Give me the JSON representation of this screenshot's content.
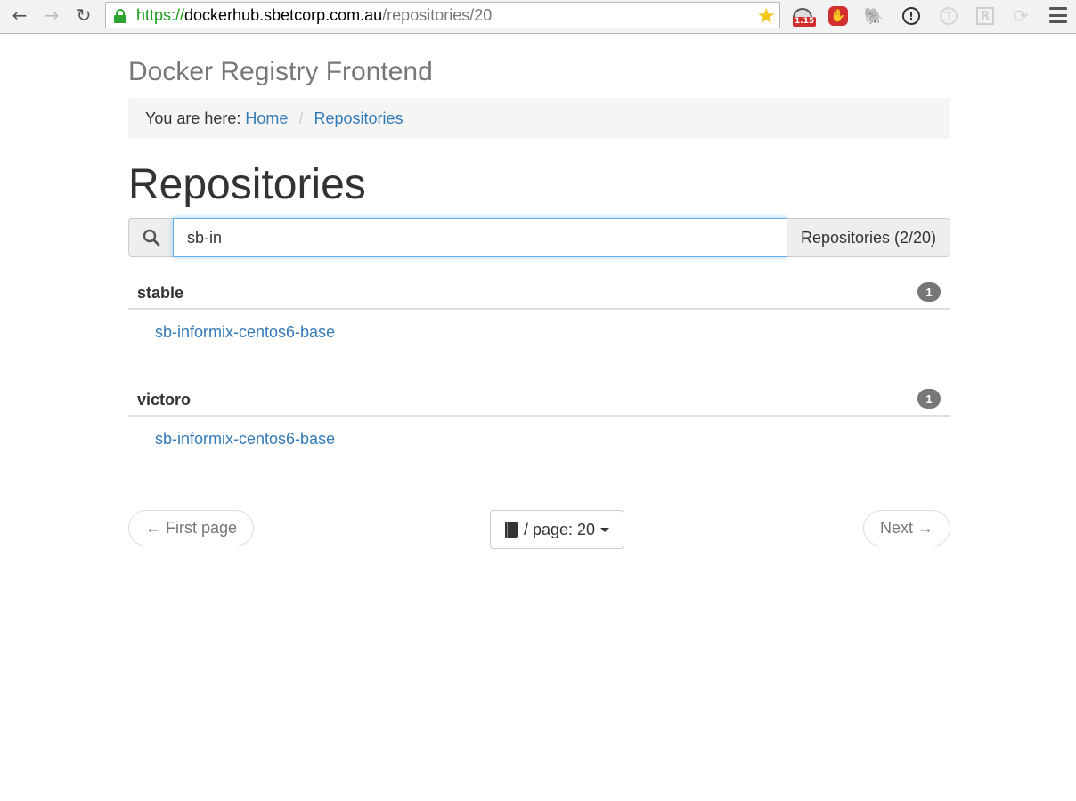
{
  "browser": {
    "url_scheme": "https://",
    "url_host": "dockerhub.sbetcorp.com.au",
    "url_path": "/repositories/20",
    "speed_badge": "1.15"
  },
  "app": {
    "title": "Docker Registry Frontend"
  },
  "breadcrumb": {
    "prefix": "You are here:",
    "items": [
      "Home",
      "Repositories"
    ],
    "separator": "/"
  },
  "page": {
    "heading": "Repositories"
  },
  "search": {
    "value": "sb-in",
    "count_label": "Repositories (2/20)"
  },
  "groups": [
    {
      "name": "stable",
      "count": "1",
      "repos": [
        "sb-informix-centos6-base"
      ]
    },
    {
      "name": "victoro",
      "count": "1",
      "repos": [
        "sb-informix-centos6-base"
      ]
    }
  ],
  "pager": {
    "first_label": "← First page",
    "page_label": "/ page: 20",
    "next_label": "Next →"
  },
  "colors": {
    "link": "#337ab7",
    "badge": "#777777",
    "secure": "#2ea52e"
  }
}
